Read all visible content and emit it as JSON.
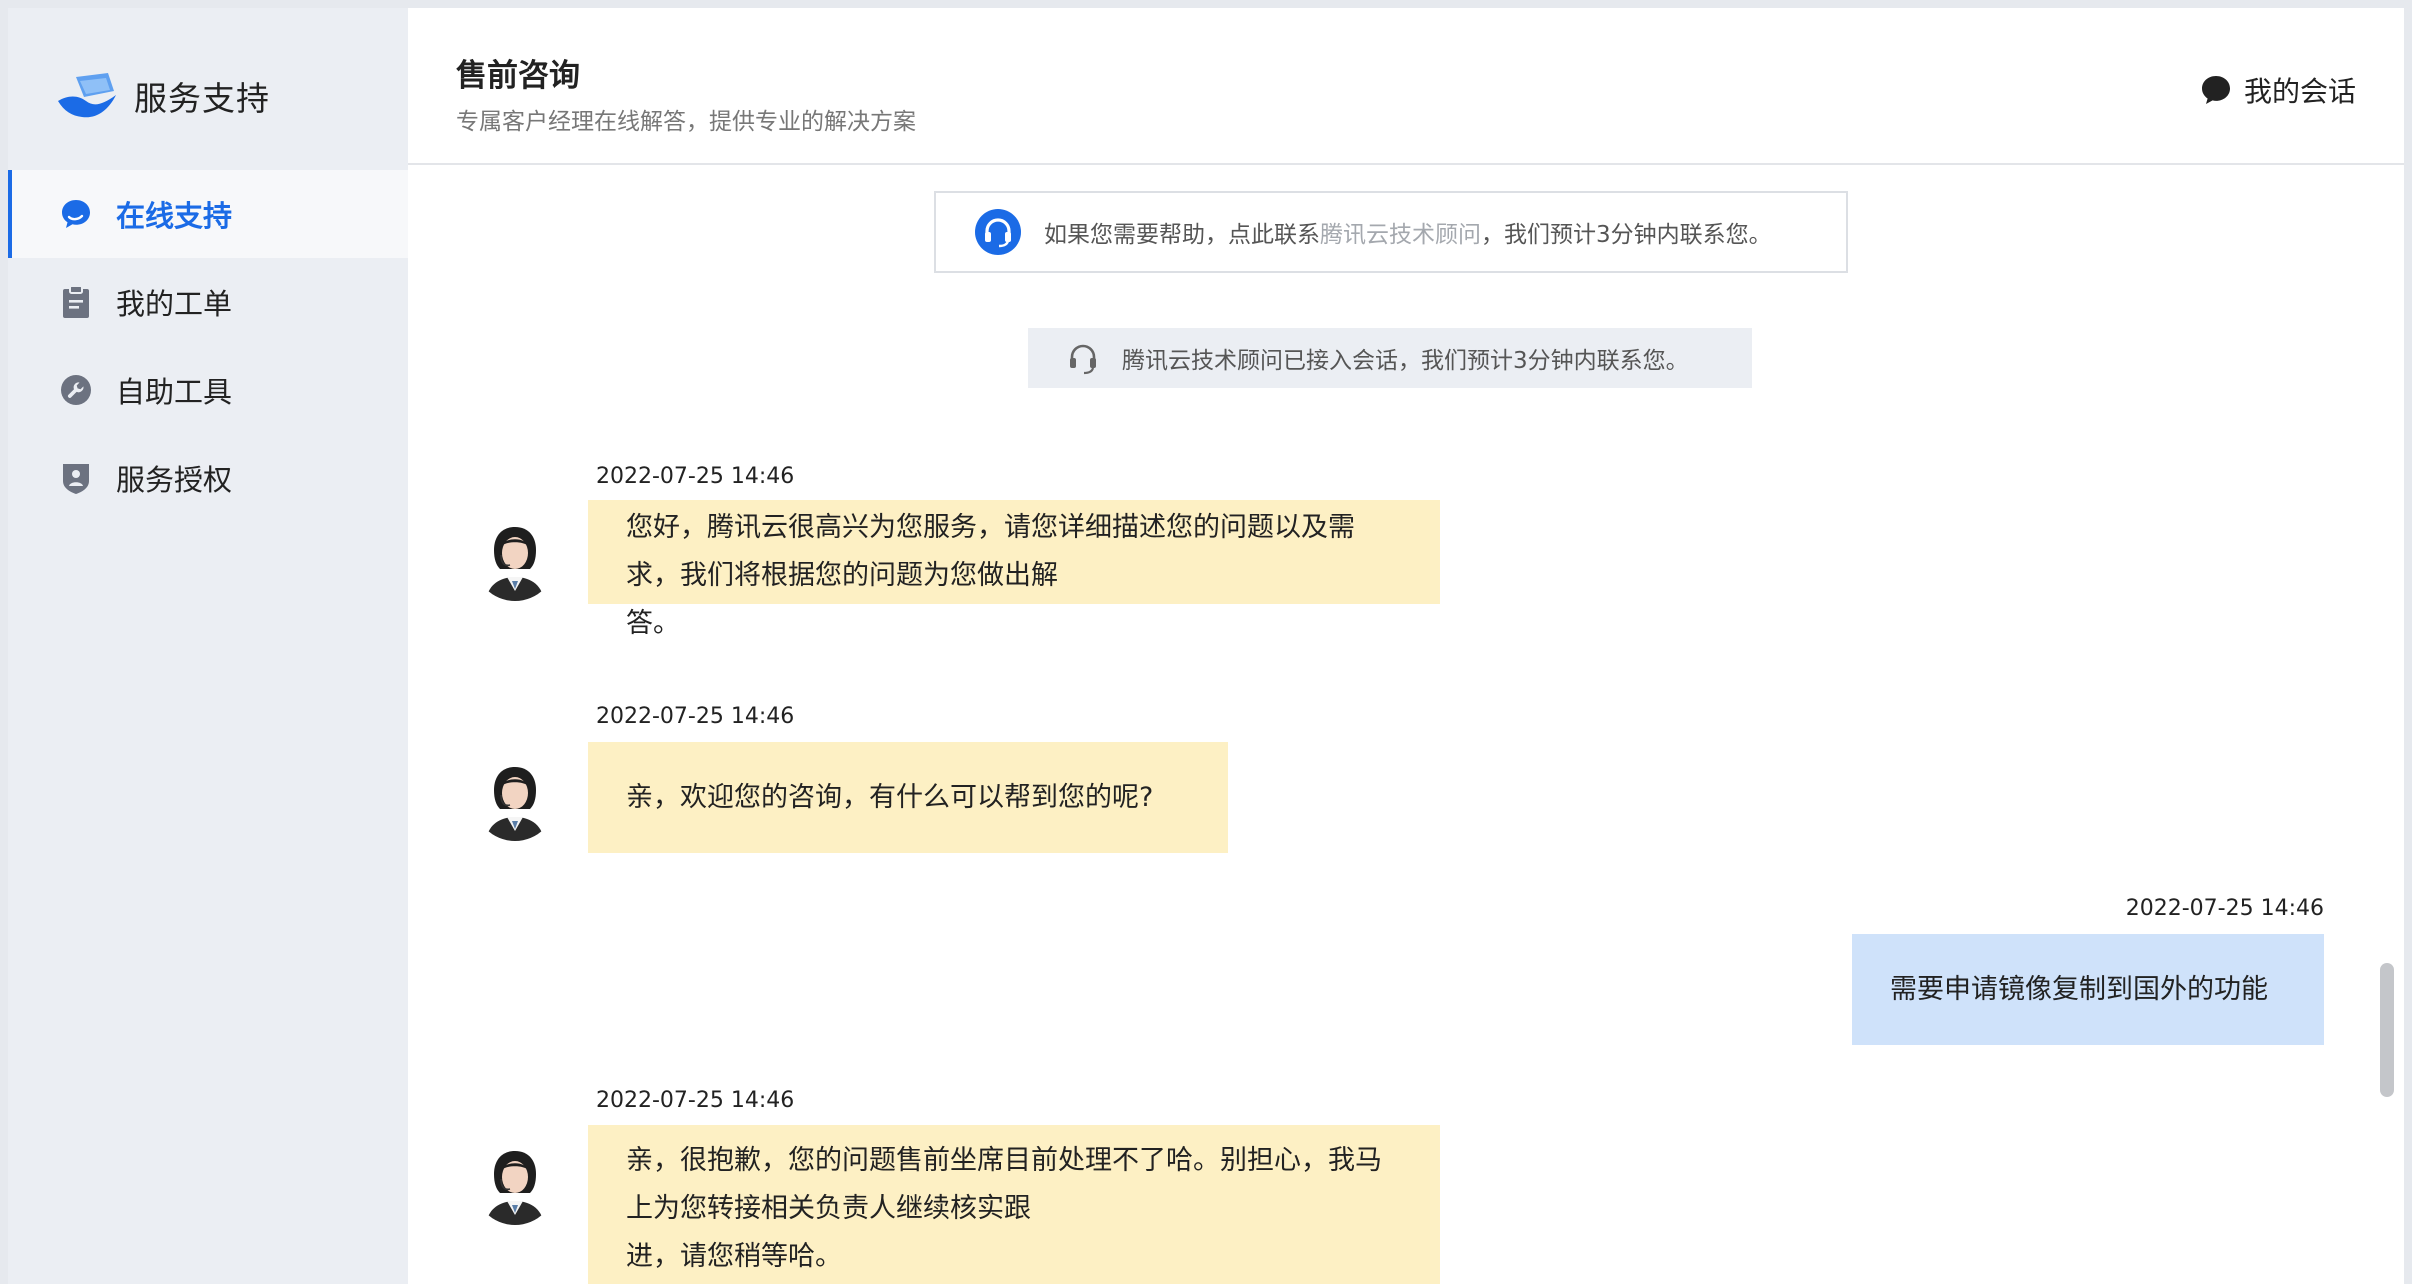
{
  "brand": {
    "name": "服务支持"
  },
  "sidebar": {
    "items": [
      {
        "label": "在线支持",
        "icon": "chat-bubble-icon",
        "active": true
      },
      {
        "label": "我的工单",
        "icon": "clipboard-icon",
        "active": false
      },
      {
        "label": "自助工具",
        "icon": "wrench-icon",
        "active": false
      },
      {
        "label": "服务授权",
        "icon": "shield-user-icon",
        "active": false
      }
    ]
  },
  "header": {
    "title": "售前咨询",
    "subtitle": "专属客户经理在线解答，提供专业的解决方案",
    "my_session_label": "我的会话"
  },
  "help_bar": {
    "prefix": "如果您需要帮助，点此联系",
    "link": "腾讯云技术顾问",
    "suffix": "，我们预计3分钟内联系您。"
  },
  "notice": {
    "text": "腾讯云技术顾问已接入会话，我们预计3分钟内联系您。"
  },
  "messages": [
    {
      "from": "agent",
      "time": "2022-07-25 14:46",
      "text_line1": "您好，腾讯云很高兴为您服务，请您详细描述您的问题以及需求，我们将根据您的问题为您做出解",
      "text_line2": "答。"
    },
    {
      "from": "agent",
      "time": "2022-07-25 14:46",
      "text_line1": "亲，欢迎您的咨询，有什么可以帮到您的呢?"
    },
    {
      "from": "user",
      "time": "2022-07-25 14:46",
      "text_line1": "需要申请镜像复制到国外的功能"
    },
    {
      "from": "agent",
      "time": "2022-07-25 14:46",
      "text_line1": "亲，很抱歉，您的问题售前坐席目前处理不了哈。别担心，我马上为您转接相关负责人继续核实跟",
      "text_line2": "进，请您稍等哈。"
    }
  ],
  "colors": {
    "accent": "#1b6be6",
    "agent_bubble": "#fdf0c4",
    "user_bubble": "#cfe2fa",
    "sidebar_bg": "#ebeef3"
  }
}
